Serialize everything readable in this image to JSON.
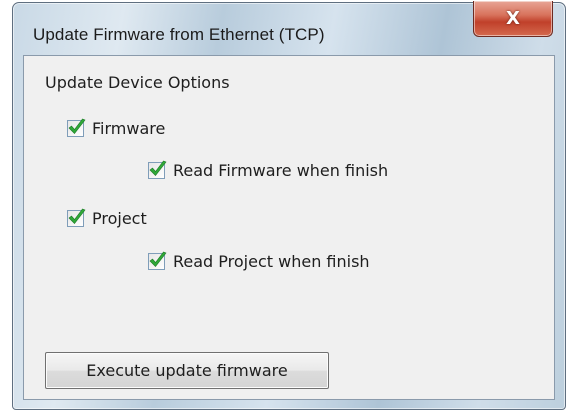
{
  "window": {
    "title": "Update Firmware from Ethernet (TCP)",
    "close_icon": "close-icon",
    "close_glyph": "X"
  },
  "options": {
    "group_label": "Update Device Options",
    "firmware": {
      "label": "Firmware",
      "checked": true
    },
    "read_firmware": {
      "label": "Read Firmware when finish",
      "checked": true
    },
    "project": {
      "label": "Project",
      "checked": true
    },
    "read_project": {
      "label": "Read Project when finish",
      "checked": true
    }
  },
  "actions": {
    "execute_label": "Execute update firmware"
  },
  "colors": {
    "check_mark": "#2fa838",
    "close_button": "#c7472f"
  }
}
